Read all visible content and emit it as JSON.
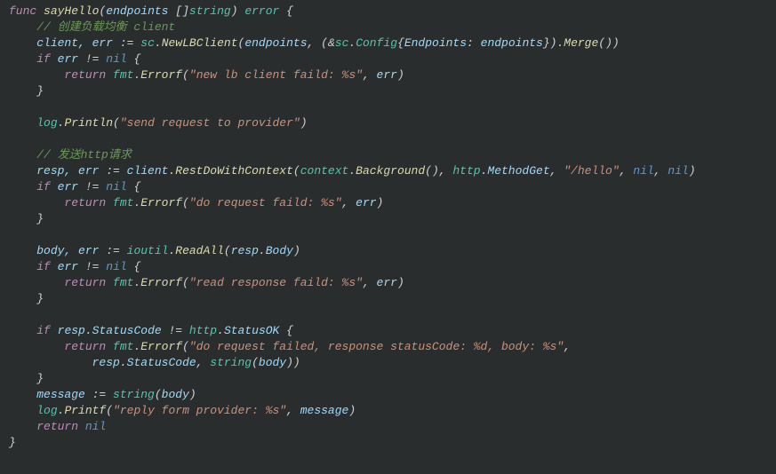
{
  "code": {
    "l1": {
      "func": "func",
      "name": "sayHello",
      "paren1": "(",
      "param": "endpoints",
      "bracket": " []",
      "ptype": "string",
      "paren2": ") ",
      "ret": "error",
      "brace": " {"
    },
    "l2": {
      "indent": "    ",
      "comment": "// 创建负载均衡 client"
    },
    "l3": {
      "indent": "    ",
      "vars": "client, err",
      "assign": " := ",
      "pkg": "sc",
      "dot1": ".",
      "fn": "NewLBClient",
      "p1": "(",
      "arg1": "endpoints",
      "c1": ", (&",
      "pkg2": "sc",
      "dot2": ".",
      "type": "Config",
      "b1": "{",
      "field": "Endpoints",
      "colon": ": ",
      "val": "endpoints",
      "b2": "}).",
      "merge": "Merge",
      "p2": "())"
    },
    "l4": {
      "indent": "    ",
      "if": "if",
      "sp": " ",
      "var": "err",
      "op": " != ",
      "nil": "nil",
      "brace": " {"
    },
    "l5": {
      "indent": "        ",
      "ret": "return",
      "sp": " ",
      "pkg": "fmt",
      "dot": ".",
      "fn": "Errorf",
      "p1": "(",
      "str": "\"new lb client faild: %s\"",
      "c": ", ",
      "arg": "err",
      "p2": ")"
    },
    "l6": {
      "indent": "    ",
      "brace": "}"
    },
    "l7": {
      "blank": " "
    },
    "l8": {
      "indent": "    ",
      "pkg": "log",
      "dot": ".",
      "fn": "Println",
      "p1": "(",
      "str": "\"send request to provider\"",
      "p2": ")"
    },
    "l9": {
      "blank": " "
    },
    "l10": {
      "indent": "    ",
      "comment": "// 发送http请求"
    },
    "l11": {
      "indent": "    ",
      "vars": "resp, err",
      "assign": " := ",
      "obj": "client",
      "dot": ".",
      "fn": "RestDoWithContext",
      "p1": "(",
      "pkg": "context",
      "dot2": ".",
      "fn2": "Background",
      "p2": "(), ",
      "pkg2": "http",
      "dot3": ".",
      "prop": "MethodGet",
      "c2": ", ",
      "str": "\"/hello\"",
      "c3": ", ",
      "nil1": "nil",
      "c4": ", ",
      "nil2": "nil",
      "p3": ")"
    },
    "l12": {
      "indent": "    ",
      "if": "if",
      "sp": " ",
      "var": "err",
      "op": " != ",
      "nil": "nil",
      "brace": " {"
    },
    "l13": {
      "indent": "        ",
      "ret": "return",
      "sp": " ",
      "pkg": "fmt",
      "dot": ".",
      "fn": "Errorf",
      "p1": "(",
      "str": "\"do request faild: %s\"",
      "c": ", ",
      "arg": "err",
      "p2": ")"
    },
    "l14": {
      "indent": "    ",
      "brace": "}"
    },
    "l15": {
      "blank": " "
    },
    "l16": {
      "indent": "    ",
      "vars": "body, err",
      "assign": " := ",
      "pkg": "ioutil",
      "dot": ".",
      "fn": "ReadAll",
      "p1": "(",
      "obj": "resp",
      "dot2": ".",
      "prop": "Body",
      "p2": ")"
    },
    "l17": {
      "indent": "    ",
      "if": "if",
      "sp": " ",
      "var": "err",
      "op": " != ",
      "nil": "nil",
      "brace": " {"
    },
    "l18": {
      "indent": "        ",
      "ret": "return",
      "sp": " ",
      "pkg": "fmt",
      "dot": ".",
      "fn": "Errorf",
      "p1": "(",
      "str": "\"read response faild: %s\"",
      "c": ", ",
      "arg": "err",
      "p2": ")"
    },
    "l19": {
      "indent": "    ",
      "brace": "}"
    },
    "l20": {
      "blank": " "
    },
    "l21": {
      "indent": "    ",
      "if": "if",
      "sp": " ",
      "obj": "resp",
      "dot": ".",
      "prop": "StatusCode",
      "op": " != ",
      "pkg": "http",
      "dot2": ".",
      "prop2": "StatusOK",
      "brace": " {"
    },
    "l22": {
      "indent": "        ",
      "ret": "return",
      "sp": " ",
      "pkg": "fmt",
      "dot": ".",
      "fn": "Errorf",
      "p1": "(",
      "str": "\"do request failed, response statusCode: %d, body: %s\"",
      "c": ","
    },
    "l23": {
      "indent": "            ",
      "obj": "resp",
      "dot": ".",
      "prop": "StatusCode",
      "c": ", ",
      "cast": "string",
      "p1": "(",
      "arg": "body",
      "p2": "))"
    },
    "l24": {
      "indent": "    ",
      "brace": "}"
    },
    "l25": {
      "indent": "    ",
      "var": "message",
      "assign": " := ",
      "cast": "string",
      "p1": "(",
      "arg": "body",
      "p2": ")"
    },
    "l26": {
      "indent": "    ",
      "pkg": "log",
      "dot": ".",
      "fn": "Printf",
      "p1": "(",
      "str": "\"reply form provider: %s\"",
      "c": ", ",
      "arg": "message",
      "p2": ")"
    },
    "l27": {
      "indent": "    ",
      "ret": "return",
      "sp": " ",
      "nil": "nil"
    },
    "l28": {
      "brace": "}"
    }
  }
}
